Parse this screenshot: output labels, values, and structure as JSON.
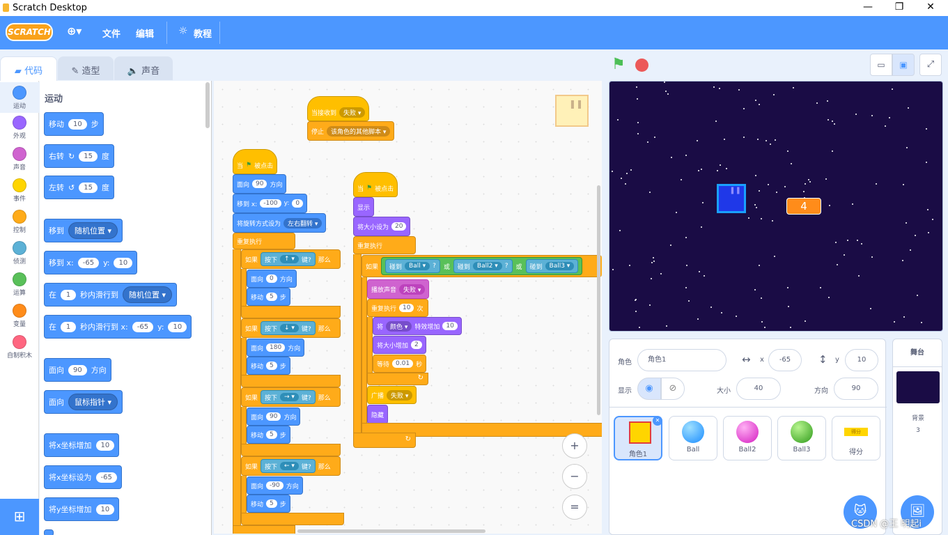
{
  "window": {
    "title": "Scratch Desktop",
    "min": "—",
    "max": "❐",
    "close": "✕"
  },
  "menu": {
    "logo": "SCRATCH",
    "globe": "⊕▾",
    "file": "文件",
    "edit": "编辑",
    "tutorials": "教程"
  },
  "tabs": [
    {
      "label": "代码"
    },
    {
      "label": "造型"
    },
    {
      "label": "声音"
    }
  ],
  "categories": [
    {
      "label": "运动",
      "color": "#4c97ff"
    },
    {
      "label": "外观",
      "color": "#9966ff"
    },
    {
      "label": "声音",
      "color": "#cf63cf"
    },
    {
      "label": "事件",
      "color": "#ffd500"
    },
    {
      "label": "控制",
      "color": "#ffab19"
    },
    {
      "label": "侦测",
      "color": "#5cb1d6"
    },
    {
      "label": "运算",
      "color": "#59c059"
    },
    {
      "label": "变量",
      "color": "#ff8c1a"
    },
    {
      "label": "自制积木",
      "color": "#ff6680"
    }
  ],
  "palette": {
    "heading": "运动",
    "move": {
      "pre": "移动",
      "val": "10",
      "post": "步"
    },
    "turn_right": {
      "pre": "右转",
      "val": "15",
      "post": "度"
    },
    "turn_left": {
      "pre": "左转",
      "val": "15",
      "post": "度"
    },
    "goto_random": {
      "pre": "移到",
      "dd": "随机位置 ▾"
    },
    "goto_xy": {
      "pre": "移到 x:",
      "x": "-65",
      "ymid": "y:",
      "y": "10"
    },
    "glide_random": {
      "pre": "在",
      "val": "1",
      "mid": "秒内滑行到",
      "dd": "随机位置 ▾"
    },
    "glide_xy": {
      "pre": "在",
      "val": "1",
      "mid": "秒内滑行到 x:",
      "x": "-65",
      "ymid": "y:",
      "y": "10"
    },
    "point_dir": {
      "pre": "面向",
      "val": "90",
      "post": "方向"
    },
    "point_towards": {
      "pre": "面向",
      "dd": "鼠标指针 ▾"
    },
    "change_x": {
      "pre": "将x坐标增加",
      "val": "10"
    },
    "set_x": {
      "pre": "将x坐标设为",
      "val": "-65"
    },
    "change_y": {
      "pre": "将y坐标增加",
      "val": "10"
    }
  },
  "script1": {
    "hat": "当接收到",
    "hat_dd": "失败 ▾",
    "stop": "停止",
    "stop_dd": "该角色的其他脚本 ▾"
  },
  "script2": {
    "hat": "当",
    "hat_post": "被点击",
    "face": "面向",
    "face_val": "90",
    "face_post": "方向",
    "goto": "移到 x:",
    "goto_x": "-100",
    "goto_y_lbl": "y:",
    "goto_y": "0",
    "rot": "将旋转方式设为",
    "rot_dd": "左右翻转 ▾",
    "forever": "重复执行",
    "ifs": [
      {
        "if": "如果",
        "key_pre": "按下",
        "key": "↑ ▾",
        "key_post": "键?",
        "then": "那么",
        "dir": "0",
        "steps": "5"
      },
      {
        "if": "如果",
        "key_pre": "按下",
        "key": "↓ ▾",
        "key_post": "键?",
        "then": "那么",
        "dir": "180",
        "steps": "5"
      },
      {
        "if": "如果",
        "key_pre": "按下",
        "key": "→ ▾",
        "key_post": "键?",
        "then": "那么",
        "dir": "90",
        "steps": "5"
      },
      {
        "if": "如果",
        "key_pre": "按下",
        "key": "← ▾",
        "key_post": "键?",
        "then": "那么",
        "dir": "-90",
        "steps": "5"
      }
    ],
    "face_lbl": "面向",
    "dir_lbl": "方向",
    "move_lbl": "移动",
    "step_lbl": "步"
  },
  "script3": {
    "hat": "当",
    "hat_post": "被点击",
    "show": "显示",
    "size": "将大小设为",
    "size_val": "20",
    "forever": "重复执行",
    "if": "如果",
    "touch": "碰到",
    "b1": "Ball ▾",
    "q": "?",
    "or": "或",
    "b2": "Ball2 ▾",
    "b3": "Ball3 ▾",
    "play": "播放声音",
    "play_dd": "失败 ▾",
    "repeat": "重复执行",
    "repeat_val": "10",
    "repeat_post": "次",
    "effect": "将",
    "effect_dd": "颜色 ▾",
    "effect_mid": "特效增加",
    "effect_val": "10",
    "chsize": "将大小增加",
    "chsize_val": "2",
    "wait": "等待",
    "wait_val": "0.01",
    "wait_post": "秒",
    "broadcast": "广播",
    "broadcast_dd": "失败 ▾",
    "hide": "隐藏"
  },
  "zoom": {
    "in": "+",
    "out": "−",
    "reset": "="
  },
  "stage": {
    "score": "4"
  },
  "sprite_info": {
    "sprite_lbl": "角色",
    "sprite_name": "角色1",
    "x_lbl": "x",
    "x": "-65",
    "y_lbl": "y",
    "y": "10",
    "show_lbl": "显示",
    "size_lbl": "大小",
    "size": "40",
    "dir_lbl": "方向",
    "dir": "90"
  },
  "sprites": [
    {
      "name": "角色1",
      "color": "#ffd500"
    },
    {
      "name": "Ball",
      "color": "#2aa5ff"
    },
    {
      "name": "Ball2",
      "color": "#e23dd0"
    },
    {
      "name": "Ball3",
      "color": "#3fb52a"
    },
    {
      "name": "得分",
      "color": "#ffd500"
    }
  ],
  "score_thumb_text": "得分",
  "stage_panel": {
    "title": "舞台",
    "backdrops_lbl": "背景",
    "backdrops": "3"
  },
  "watermark": "CSDN @王 明起i"
}
